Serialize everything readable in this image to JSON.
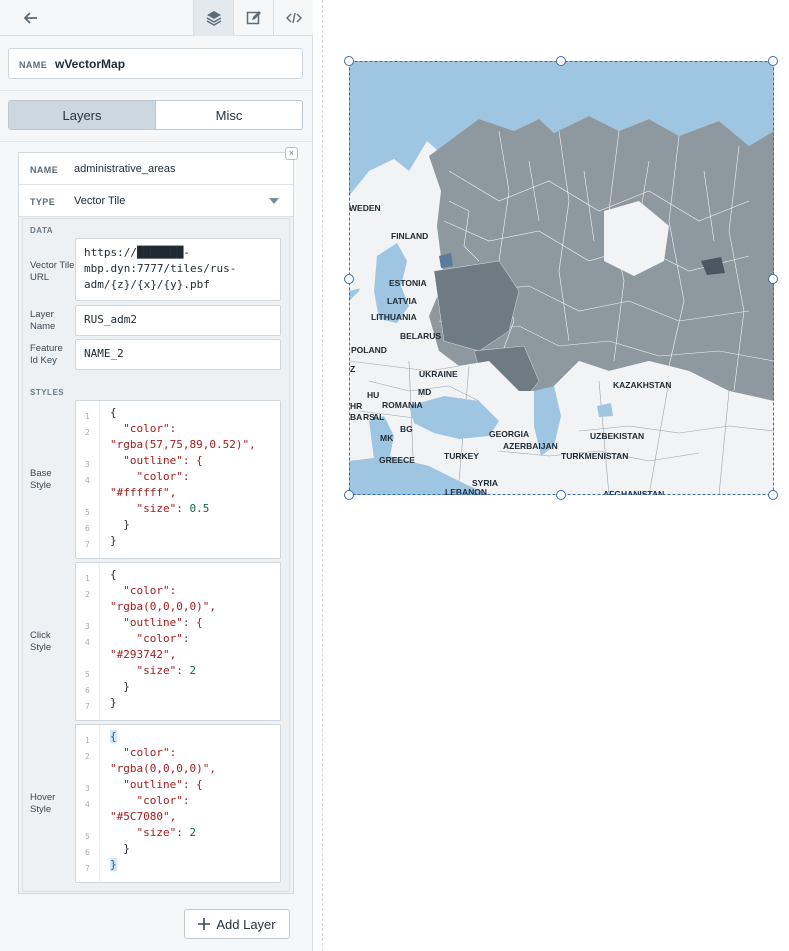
{
  "toolbar": {
    "icons": [
      "back-arrow-icon",
      "layers-icon",
      "edit-icon",
      "code-icon"
    ]
  },
  "widget": {
    "name_label": "NAME",
    "name_value": "wVectorMap"
  },
  "tabs": [
    {
      "label": "Layers",
      "active": true
    },
    {
      "label": "Misc",
      "active": false
    }
  ],
  "layer": {
    "name_label": "NAME",
    "name_value": "administrative_areas",
    "type_label": "TYPE",
    "type_value": "Vector Tile",
    "data_section": "DATA",
    "url_label": "Vector Tile URL",
    "url_lines": [
      "https://███████-",
      "mbp.dyn:7777/tiles/rus-",
      "adm/{z}/{x}/{y}.pbf"
    ],
    "layer_name_label": "Layer Name",
    "layer_name_value": "RUS_adm2",
    "feature_id_label": "Feature Id Key",
    "feature_id_value": "NAME_2",
    "styles_section": "STYLES",
    "styles": [
      {
        "label": "Base Style",
        "color": "\"rgba(57,75,89,0.52)\",",
        "outline_color": "\"#ffffff\",",
        "size": "0.5"
      },
      {
        "label": "Click Style",
        "color": "\"rgba(0,0,0,0)\",",
        "outline_color": "\"#293742\",",
        "size": "2"
      },
      {
        "label": "Hover Style",
        "color": "\"rgba(0,0,0,0)\",",
        "outline_color": "\"#5C7080\",",
        "size": "2"
      }
    ],
    "code_keys": {
      "color": "\"color\":",
      "outline": "\"outline\": {",
      "size": "\"size\":"
    },
    "line_numbers": [
      "1",
      "2",
      "3",
      "4",
      "5",
      "6",
      "7"
    ]
  },
  "add_layer_label": "Add Layer",
  "map": {
    "labels": [
      "WEDEN",
      "FINLAND",
      "ESTONIA",
      "LATVIA",
      "LITHUANIA",
      "BELARUS",
      "POLAND",
      "UKRAINE",
      "KAZAKHSTAN",
      "HU",
      "MD",
      "ROMANIA",
      "HR",
      "BA",
      "RS",
      "BG",
      "MK",
      "AL",
      "GREECE",
      "GEORGIA",
      "AZERBAIJAN",
      "UZBEKISTAN",
      "TURKMENISTAN",
      "TURKEY",
      "SYRIA",
      "LEBANON",
      "AFGHANISTAN",
      "Z"
    ],
    "colors": {
      "water": "#9ec6e3",
      "land": "#f1f3f5",
      "region": "#8e999f",
      "region_dark": "#5f6c74",
      "accent": "#3b6ea8"
    }
  }
}
